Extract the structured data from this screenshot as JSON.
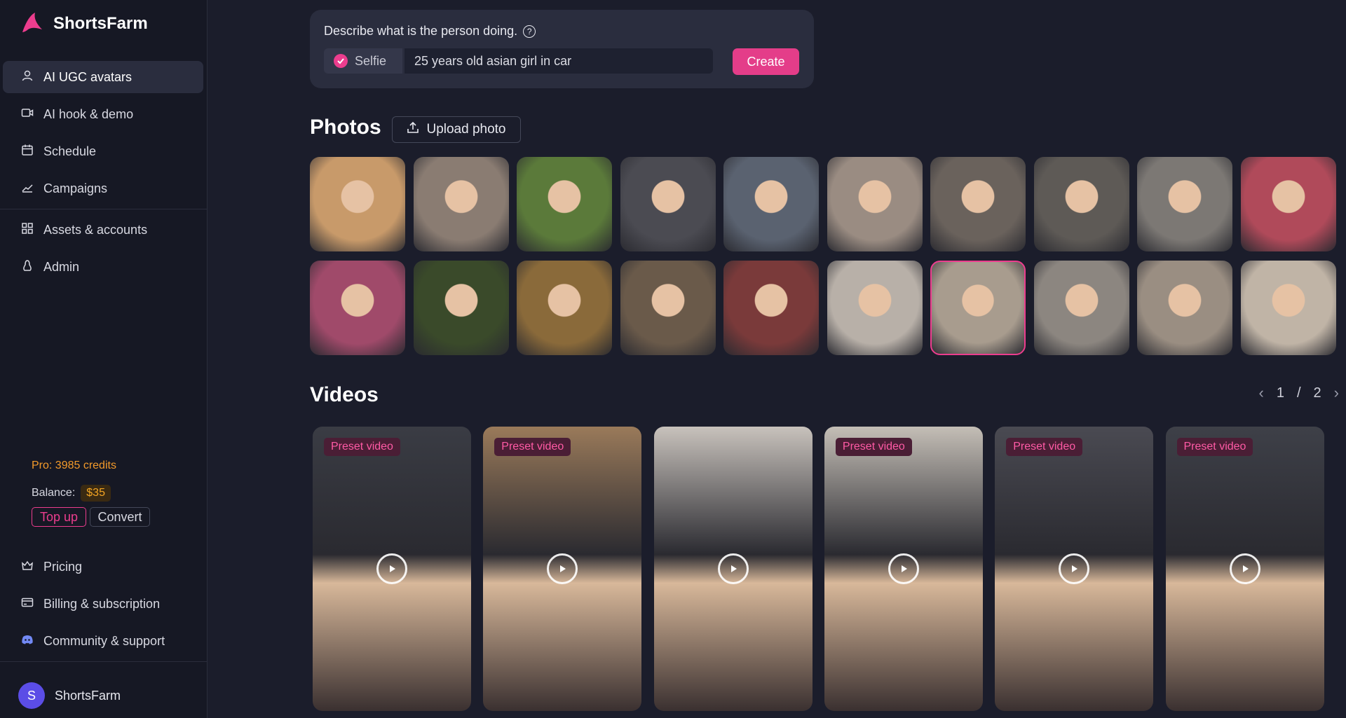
{
  "brand": {
    "name": "ShortsFarm"
  },
  "sidebar": {
    "items": [
      {
        "label": "AI UGC avatars",
        "icon": "user-icon",
        "active": true
      },
      {
        "label": "AI hook & demo",
        "icon": "video-camera-icon"
      },
      {
        "label": "Schedule",
        "icon": "calendar-icon"
      },
      {
        "label": "Campaigns",
        "icon": "chart-line-icon"
      },
      {
        "label": "Assets & accounts",
        "icon": "grid-icon"
      },
      {
        "label": "Admin",
        "icon": "tux-icon"
      }
    ],
    "credits": "Pro: 3985 credits",
    "balance_label": "Balance:",
    "balance_value": "$35",
    "topup_label": "Top up",
    "convert_label": "Convert",
    "bottom_items": [
      {
        "label": "Pricing",
        "icon": "crown-icon"
      },
      {
        "label": "Billing & subscription",
        "icon": "credit-card-icon"
      },
      {
        "label": "Community & support",
        "icon": "discord-icon"
      }
    ],
    "user": {
      "initial": "S",
      "name": "ShortsFarm"
    }
  },
  "prompt": {
    "label": "Describe what is the person doing.",
    "selfie_label": "Selfie",
    "selfie_checked": true,
    "input_value": "25 years old asian girl in car",
    "create_label": "Create"
  },
  "photos": {
    "title": "Photos",
    "upload_label": "Upload photo",
    "selected_index": 16,
    "items": [
      {
        "tone": "#c89a6a"
      },
      {
        "tone": "#8a7c72"
      },
      {
        "tone": "#5b7a3a"
      },
      {
        "tone": "#4b4b52"
      },
      {
        "tone": "#5a6270"
      },
      {
        "tone": "#9a8c82"
      },
      {
        "tone": "#6a625c"
      },
      {
        "tone": "#5e5a56"
      },
      {
        "tone": "#7c7874"
      },
      {
        "tone": "#b04a5a"
      },
      {
        "tone": "#a04a6a"
      },
      {
        "tone": "#3a4a2a"
      },
      {
        "tone": "#8a6a3a"
      },
      {
        "tone": "#6a5a4a"
      },
      {
        "tone": "#7a3a3a"
      },
      {
        "tone": "#b8b0a8"
      },
      {
        "tone": "#a89c8e"
      },
      {
        "tone": "#8c8680"
      },
      {
        "tone": "#9a8e82"
      },
      {
        "tone": "#c0b4a6"
      }
    ]
  },
  "videos": {
    "title": "Videos",
    "page_current": "1",
    "page_sep": "/",
    "page_total": "2",
    "items": [
      {
        "badge": "Preset video",
        "tone": "#3a3c44"
      },
      {
        "badge": "Preset video",
        "tone": "#9a7a5a"
      },
      {
        "badge": "",
        "tone": "#c8c2bc"
      },
      {
        "badge": "Preset video",
        "tone": "#c4beb6"
      },
      {
        "badge": "Preset video",
        "tone": "#4a4a52"
      },
      {
        "badge": "Preset video",
        "tone": "#3e4048"
      }
    ]
  }
}
